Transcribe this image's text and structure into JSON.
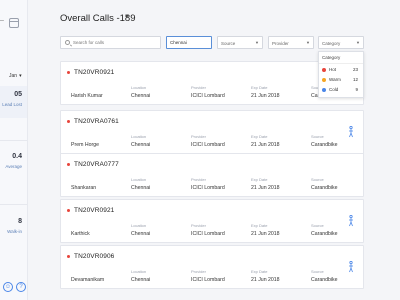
{
  "page": {
    "title": "Overall Calls -189"
  },
  "sidebar": {
    "month": "Jan",
    "stats": [
      {
        "value": "05",
        "label": "Lead Lost"
      },
      {
        "value": "0.4",
        "label": "Average"
      },
      {
        "value": "8",
        "label": "Walk-in"
      }
    ]
  },
  "filters": {
    "search_placeholder": "Search for calls",
    "location_value": "Chennai",
    "source_label": "Source",
    "provider_label": "Provider",
    "category_label": "Category"
  },
  "category_panel": {
    "header": "Category",
    "options": [
      {
        "label": "Hot",
        "count": "23",
        "color": "#e8453c"
      },
      {
        "label": "Warm",
        "count": "12",
        "color": "#f5a623"
      },
      {
        "label": "Cold",
        "count": "9",
        "color": "#4a86e8"
      }
    ]
  },
  "column_labels": {
    "location": "Location",
    "provider": "Provider",
    "exp_date": "Exp Date",
    "source": "Source"
  },
  "calls": [
    {
      "reg": "TN20VR0921",
      "name": "Harish Kumar",
      "location": "Chennai",
      "provider": "ICICI Lombard",
      "exp_date": "21 Jun 2018",
      "source": "Carandbike",
      "walk_in": false
    },
    {
      "reg": "TN20VRA0761",
      "name": "Prem Horge",
      "location": "Chennai",
      "provider": "ICICI Lombard",
      "exp_date": "21 Jun 2018",
      "source": "Carandbike",
      "walk_in": true
    },
    {
      "reg": "TN20VRA0777",
      "name": "Shankaran",
      "location": "Chennai",
      "provider": "ICICI Lombard",
      "exp_date": "21 Jun 2018",
      "source": "Carandbike",
      "walk_in": false
    },
    {
      "reg": "TN20VR0921",
      "name": "Karthick",
      "location": "Chennai",
      "provider": "ICICI Lombard",
      "exp_date": "21 Jun 2018",
      "source": "Carandbike",
      "walk_in": true
    },
    {
      "reg": "TN20VR0906",
      "name": "Devamanikam",
      "location": "Chennai",
      "provider": "ICICI Lombard",
      "exp_date": "21 Jun 2018",
      "source": "Carandbike",
      "walk_in": true
    }
  ]
}
